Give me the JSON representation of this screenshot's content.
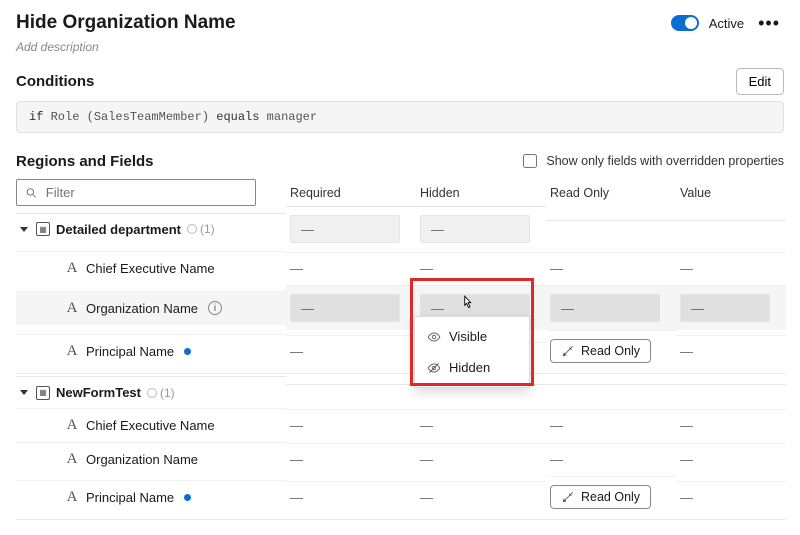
{
  "header": {
    "title": "Hide Organization Name",
    "active_label": "Active",
    "description_placeholder": "Add description"
  },
  "conditions": {
    "title": "Conditions",
    "edit_label": "Edit",
    "expression": {
      "if": "if",
      "subject": "Role (SalesTeamMember)",
      "op": "equals",
      "value": "manager"
    }
  },
  "regions": {
    "title": "Regions and Fields",
    "show_only_label": "Show only fields with overridden properties",
    "filter_placeholder": "Filter",
    "columns": {
      "required": "Required",
      "hidden": "Hidden",
      "readonly": "Read Only",
      "value": "Value"
    },
    "dash": "—",
    "readonly_pill": "Read Only",
    "dropdown": {
      "visible": "Visible",
      "hidden": "Hidden"
    },
    "groups": [
      {
        "name": "Detailed department",
        "count": "(1)",
        "fields": [
          {
            "name": "Chief Executive Name"
          },
          {
            "name": "Organization Name",
            "info": true,
            "highlight": true
          },
          {
            "name": "Principal Name",
            "dot": true,
            "readonly": true
          }
        ]
      },
      {
        "name": "NewFormTest",
        "count": "(1)",
        "fields": [
          {
            "name": "Chief Executive Name"
          },
          {
            "name": "Organization Name"
          },
          {
            "name": "Principal Name",
            "dot": true,
            "readonly": true
          }
        ]
      }
    ]
  }
}
